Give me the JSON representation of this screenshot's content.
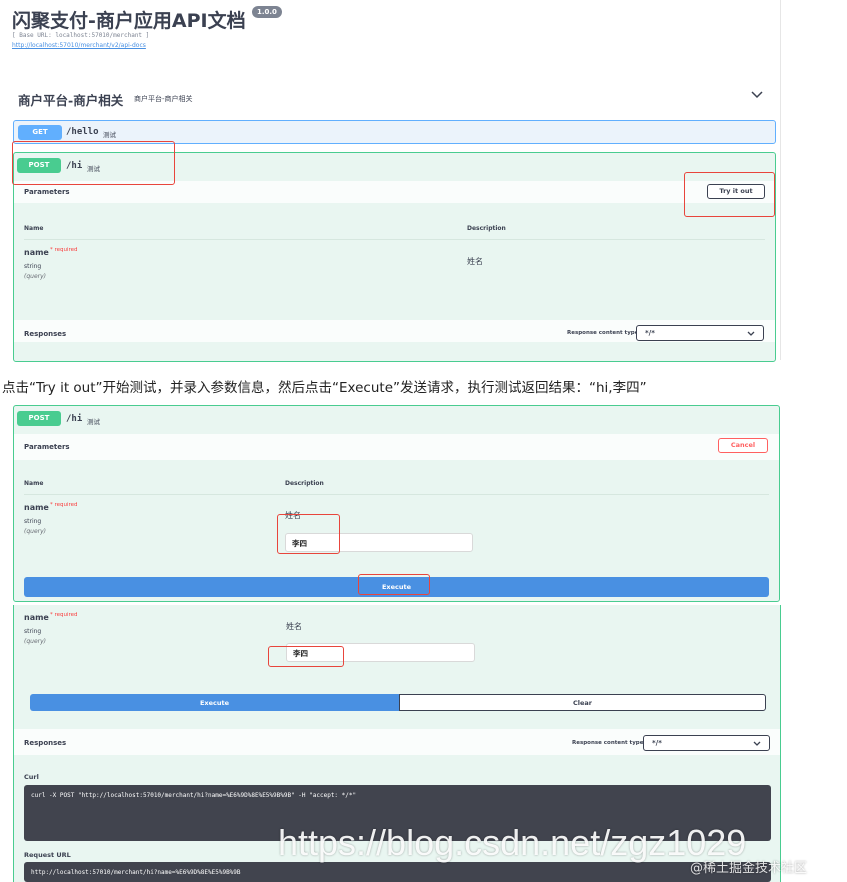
{
  "header": {
    "title": "闪聚支付-商户应用API文档",
    "version": "1.0.0",
    "base_url": "[ Base URL: localhost:57010/merchant ]",
    "api_docs_link": "http://localhost:57010/merchant/v2/api-docs"
  },
  "tag": {
    "name": "商户平台-商户相关",
    "description": "商户平台-商户相关"
  },
  "op_get": {
    "method": "GET",
    "path": "/hello",
    "summary": "测试"
  },
  "op_post": {
    "method": "POST",
    "path": "/hi",
    "summary": "测试"
  },
  "panel1": {
    "parameters_label": "Parameters",
    "try_button": "Try it out",
    "col_name": "Name",
    "col_description": "Description",
    "param_name": "name",
    "required": "* required",
    "param_type": "string",
    "param_in": "(query)",
    "param_desc": "姓名",
    "responses_label": "Responses",
    "content_type_label": "Response content type",
    "content_type_value": "*/*"
  },
  "caption": "点击“Try it out”开始测试，并录入参数信息，然后点击“Execute”发送请求，执行测试返回结果：“hi,李四”",
  "panel2": {
    "parameters_label": "Parameters",
    "cancel_button": "Cancel",
    "col_name": "Name",
    "col_description": "Description",
    "param_name": "name",
    "required": "* required",
    "param_type": "string",
    "param_in": "(query)",
    "param_desc": "姓名",
    "input_value": "李四",
    "execute_button": "Execute"
  },
  "panel3": {
    "param_name": "name",
    "required": "* required",
    "param_type": "string",
    "param_in": "(query)",
    "param_desc": "姓名",
    "input_value": "李四",
    "execute_button": "Execute",
    "clear_button": "Clear",
    "responses_label": "Responses",
    "content_type_label": "Response content type",
    "content_type_value": "*/*",
    "curl_label": "Curl",
    "curl_command": "curl -X POST \"http://localhost:57010/merchant/hi?name=%E6%9D%8E%E5%9B%9B\" -H \"accept: */*\"",
    "request_url_label": "Request URL",
    "request_url": "http://localhost:57010/merchant/hi?name=%E6%9D%8E%E5%9B%9B"
  },
  "watermark": {
    "text": "https://blog.csdn.net/zgz1029",
    "brand": "@稀土掘金技术社区"
  },
  "colors": {
    "get": "#61affe",
    "post": "#49cc90",
    "execute": "#4990e2",
    "cancel": "#ff6060",
    "highlight": "#e8453c"
  }
}
